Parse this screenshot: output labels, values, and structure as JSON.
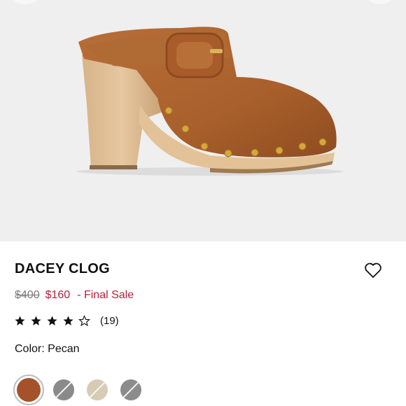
{
  "product": {
    "title": "DACEY CLOG",
    "original_price": "$400",
    "sale_price": "$160",
    "sale_note": "- Final Sale",
    "rating": 4,
    "rating_max": 5,
    "review_count": "(19)",
    "color_label": "Color:",
    "color_value": "Pecan"
  },
  "swatches": [
    {
      "name": "Pecan",
      "color": "#a5522a",
      "selected": true,
      "available": true
    },
    {
      "name": "Grey",
      "color": "#8a8a8a",
      "selected": false,
      "available": false
    },
    {
      "name": "Bone",
      "color": "#d7cbb6",
      "selected": false,
      "available": false
    },
    {
      "name": "Charcoal",
      "color": "#8c8c8c",
      "selected": false,
      "available": false
    }
  ],
  "icons": {
    "favorite": "heart-outline-icon",
    "star_full": "star-filled-icon",
    "star_empty": "star-outline-icon"
  },
  "colors": {
    "sale": "#b5213b",
    "hero_bg": "#efefef"
  }
}
